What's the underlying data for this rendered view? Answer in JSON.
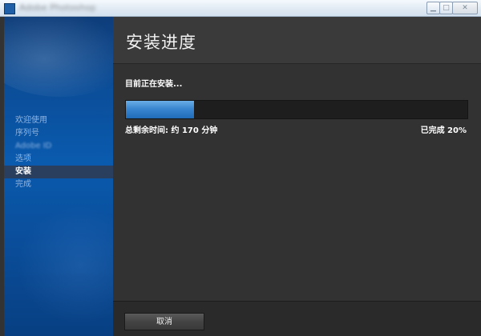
{
  "window": {
    "title": "Adobe Photoshop CS5",
    "controls": [
      "minimize-icon",
      "maximize-icon",
      "close-icon"
    ]
  },
  "sidebar": {
    "items": [
      {
        "label": "欢迎使用",
        "state": "done"
      },
      {
        "label": "序列号",
        "state": "done"
      },
      {
        "label": "Adobe ID",
        "state": "done"
      },
      {
        "label": "选项",
        "state": "done"
      },
      {
        "label": "安装",
        "state": "active"
      },
      {
        "label": "完成",
        "state": "pending"
      }
    ]
  },
  "header": {
    "title": "安装进度"
  },
  "main": {
    "status": "目前正在安装...",
    "progress_percent": 20,
    "remaining": "总剩余时间: 约 170 分钟",
    "completed": "已完成 20%"
  },
  "footer": {
    "cancel_label": "取消"
  },
  "colors": {
    "accent": "#3a86cf",
    "sidebar": "#0a5aae",
    "panel": "#333333"
  }
}
